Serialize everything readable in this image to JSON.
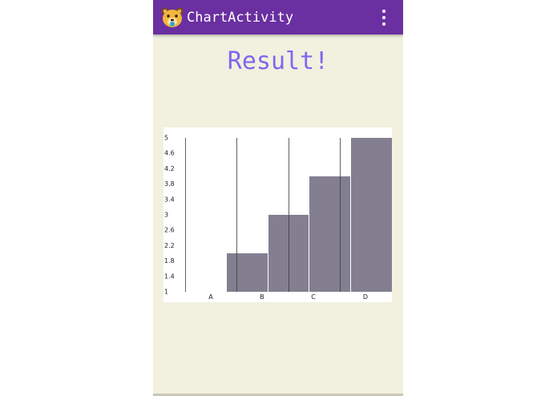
{
  "app": {
    "title": "ChartActivity",
    "icon": "bear-face-icon",
    "menu_icon": "overflow-menu-icon",
    "appbar_color": "#6a2fa0",
    "background_color": "#f2f0df"
  },
  "main": {
    "heading": "Result!",
    "heading_color": "#7b68ee"
  },
  "chart_data": {
    "type": "bar",
    "categories": [
      "A",
      "B",
      "C",
      "D"
    ],
    "values": [
      1,
      2,
      3,
      4,
      5
    ],
    "bar_labels": [
      "",
      "",
      "",
      "",
      ""
    ],
    "ylim": [
      1,
      5
    ],
    "yticks": [
      "5",
      "4.6",
      "4.2",
      "3.8",
      "3.4",
      "3",
      "2.6",
      "2.2",
      "1.8",
      "1.4",
      "1"
    ],
    "bar_color": "#837f91",
    "grid": "vertical",
    "legend": "none"
  }
}
